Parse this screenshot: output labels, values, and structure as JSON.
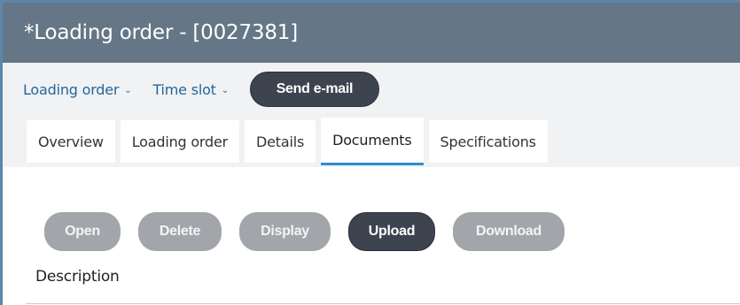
{
  "window": {
    "title": "*Loading order - [0027381]"
  },
  "toolbar": {
    "loading_order_label": "Loading order",
    "time_slot_label": "Time slot",
    "send_email_label": "Send e-mail"
  },
  "tabs": [
    {
      "label": "Overview",
      "active": false
    },
    {
      "label": "Loading order",
      "active": false
    },
    {
      "label": "Details",
      "active": false
    },
    {
      "label": "Documents",
      "active": true
    },
    {
      "label": "Specifications",
      "active": false
    }
  ],
  "actions": {
    "open_label": "Open",
    "delete_label": "Delete",
    "display_label": "Display",
    "upload_label": "Upload",
    "download_label": "Download"
  },
  "table": {
    "columns": [
      "Description"
    ]
  },
  "colors": {
    "titlebar": "#657786",
    "accent": "#23669c",
    "tab_underline": "#2f8bd0",
    "dark_button": "#3d4450",
    "disabled_button": "#a2a6ab"
  }
}
